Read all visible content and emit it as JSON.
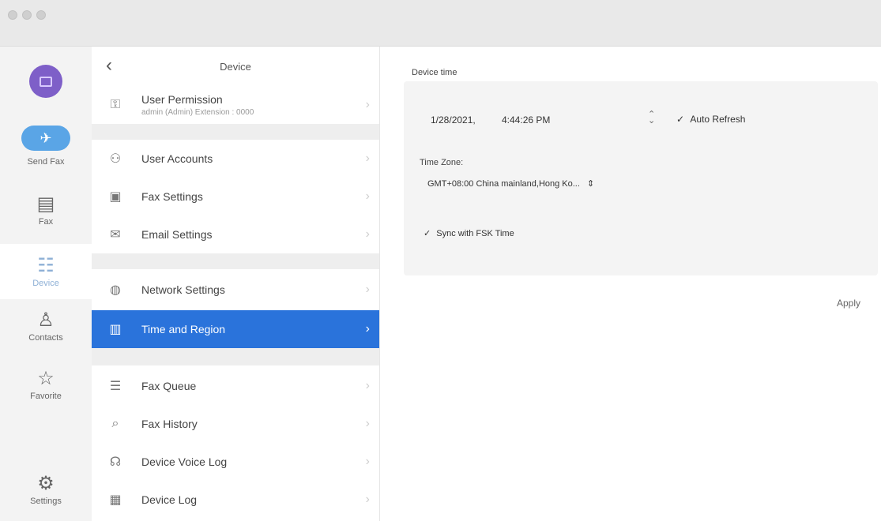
{
  "rail": {
    "send_fax": "Send Fax",
    "items": [
      {
        "label": "Fax",
        "icon": "fax-icon"
      },
      {
        "label": "Device",
        "icon": "device-icon",
        "active": true
      },
      {
        "label": "Contacts",
        "icon": "contacts-icon"
      },
      {
        "label": "Favorite",
        "icon": "star-icon"
      },
      {
        "label": "Settings",
        "icon": "gear-icon"
      }
    ]
  },
  "list": {
    "title": "Device",
    "items": [
      {
        "label": "User Permission",
        "sub": "admin (Admin)   Extension : 0000"
      },
      {
        "label": "User Accounts"
      },
      {
        "label": "Fax Settings"
      },
      {
        "label": "Email Settings"
      },
      {
        "label": "Network Settings"
      },
      {
        "label": "Time and Region",
        "active": true
      },
      {
        "label": "Fax Queue"
      },
      {
        "label": "Fax History"
      },
      {
        "label": "Device Voice Log"
      },
      {
        "label": "Device Log"
      }
    ]
  },
  "panel": {
    "device_time_label": "Device time",
    "date": "1/28/2021,",
    "time": "4:44:26 PM",
    "auto_refresh": "Auto Refresh",
    "time_zone_label": "Time Zone:",
    "time_zone_value": "GMT+08:00  China mainland,Hong Ko...",
    "sync": "Sync with FSK Time",
    "apply": "Apply"
  },
  "colors": {
    "accent": "#2a73db",
    "avatar": "#7e5fc8",
    "send_fax": "#5aa5e6"
  }
}
